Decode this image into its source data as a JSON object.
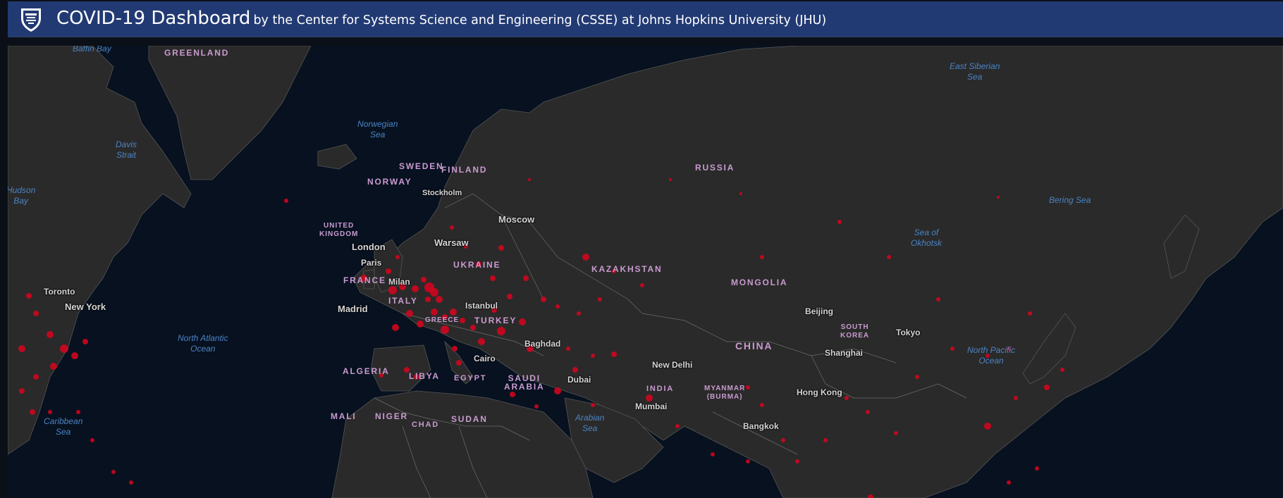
{
  "header": {
    "title": "COVID-19 Dashboard",
    "subtitle": "by the Center for Systems Science and Engineering (CSSE) at Johns Hopkins University (JHU)"
  },
  "colors": {
    "header_bg": "#223a73",
    "ocean": "#07111f",
    "land": "#2a2a2a",
    "case_marker": "#d9041f",
    "country_label": "#c99bd0",
    "water_label": "#4b83c4"
  },
  "map": {
    "countries": {
      "greenland": "GREENLAND",
      "sweden": "SWEDEN",
      "finland": "FINLAND",
      "norway": "NORWAY",
      "russia": "RUSSIA",
      "uk": "UNITED\nKINGDOM",
      "ukraine": "UKRAINE",
      "kazakhstan": "KAZAKHSTAN",
      "mongolia": "MONGOLIA",
      "france": "FRANCE",
      "italy": "ITALY",
      "greece": "GREECE",
      "turkey": "TURKEY",
      "china": "CHINA",
      "south_korea": "SOUTH\nKOREA",
      "algeria": "ALGERIA",
      "libya": "LIBYA",
      "egypt": "EGYPT",
      "saudi_arabia": "SAUDI\nARABIA",
      "india": "INDIA",
      "myanmar": "MYANMAR\n(BURMA)",
      "mali": "MALI",
      "niger": "NIGER",
      "chad": "CHAD",
      "sudan": "SUDAN"
    },
    "cities": {
      "stockholm": "Stockholm",
      "moscow": "Moscow",
      "warsaw": "Warsaw",
      "london": "London",
      "paris": "Paris",
      "milan": "Milan",
      "madrid": "Madrid",
      "istanbul": "Istanbul",
      "toronto": "Toronto",
      "new_york": "New York",
      "beijing": "Beijing",
      "tokyo": "Tokyo",
      "shanghai": "Shanghai",
      "baghdad": "Baghdad",
      "cairo": "Cairo",
      "dubai": "Dubai",
      "new_delhi": "New Delhi",
      "mumbai": "Mumbai",
      "hong_kong": "Hong Kong",
      "bangkok": "Bangkok"
    },
    "water": {
      "baffin_bay": "Baffin Bay",
      "davis_strait": "Davis\nStrait",
      "hudson_bay": "Hudson\nBay",
      "norwegian_sea": "Norwegian\nSea",
      "east_siberian_sea": "East Siberian\nSea",
      "bering_sea": "Bering Sea",
      "sea_of_okhotsk": "Sea of\nOkhotsk",
      "north_atlantic": "North Atlantic\nOcean",
      "north_pacific": "North Pacific\nOcean",
      "arabian_sea": "Arabian\nSea",
      "caribbean_sea": "Caribbean\nSea"
    }
  }
}
